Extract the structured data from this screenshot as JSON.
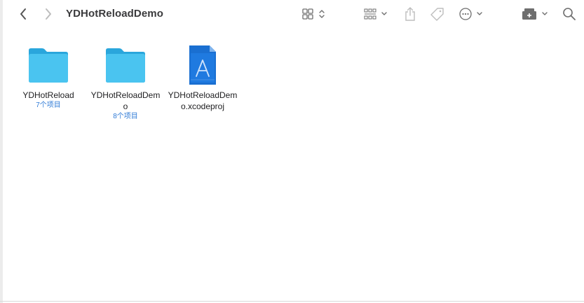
{
  "window": {
    "title": "YDHotReloadDemo"
  },
  "toolbar": {
    "back_icon": "chevron-left-icon",
    "forward_icon": "chevron-right-icon",
    "view_icon": "icon-grid-icon",
    "group_icon": "group-by-icon",
    "share_icon": "share-icon",
    "tag_icon": "tag-icon",
    "more_icon": "ellipsis-circle-icon",
    "drive_icon": "drive-icon",
    "search_icon": "search-icon"
  },
  "files": [
    {
      "name": "YDHotReload",
      "meta": "7个项目",
      "kind": "folder"
    },
    {
      "name": "YDHotReloadDemo",
      "meta": "8个项目",
      "kind": "folder"
    },
    {
      "name": "YDHotReloadDemo.xcodeproj",
      "meta": "",
      "kind": "xcodeproj"
    }
  ],
  "colors": {
    "folder": "#34b8ea",
    "link": "#2f7bd6",
    "xcode": "#1a6fd1"
  }
}
